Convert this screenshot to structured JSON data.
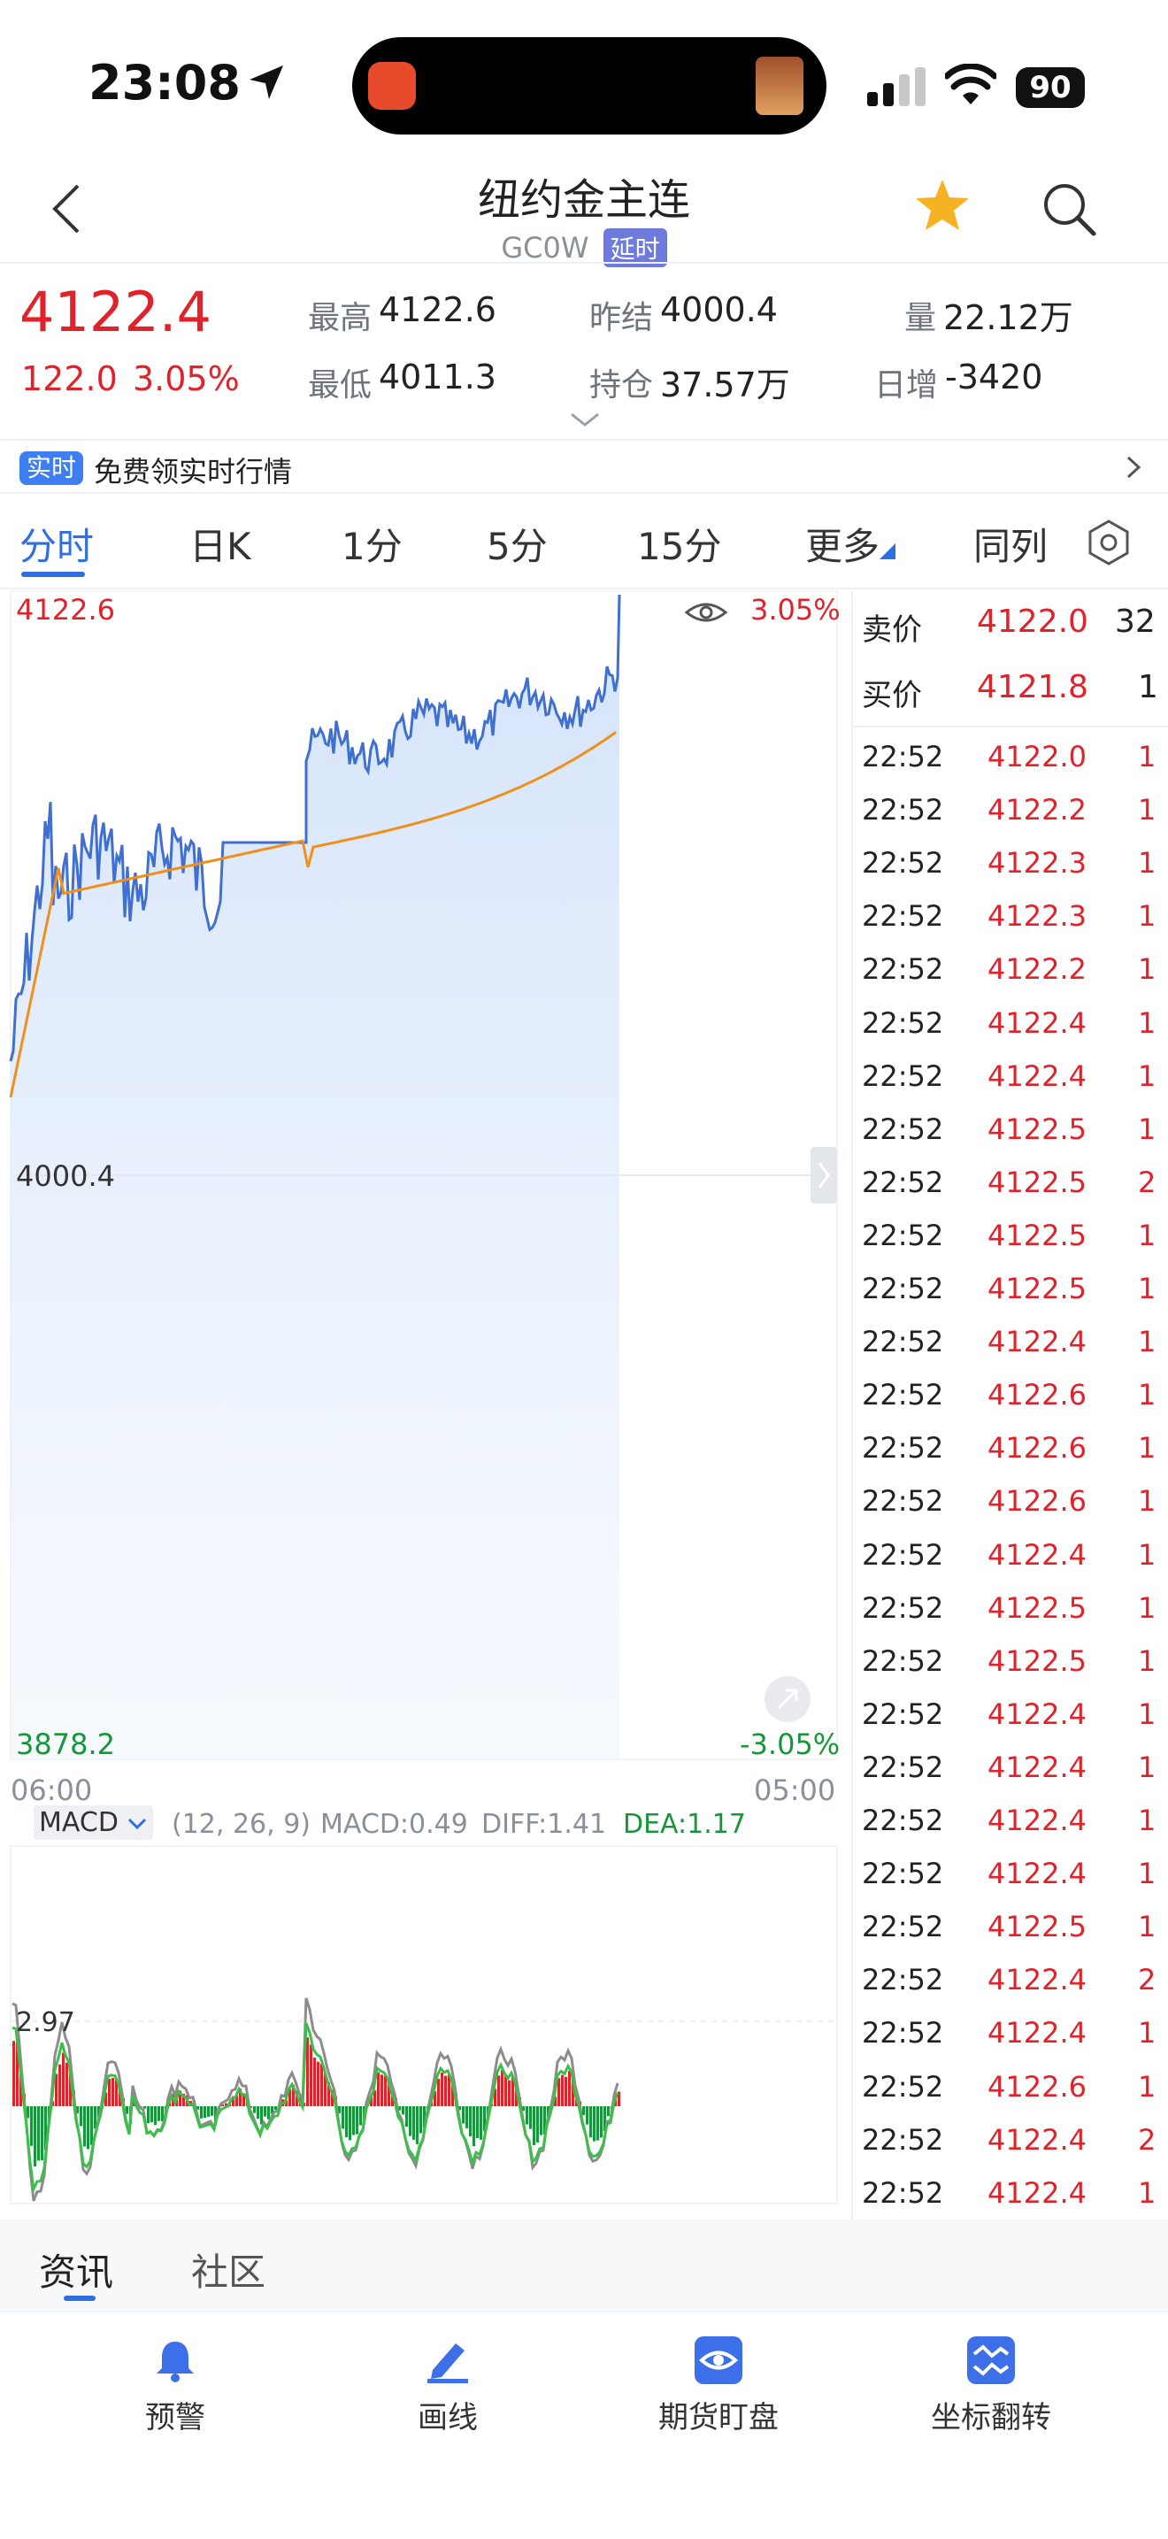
{
  "status": {
    "time": "23:08",
    "battery": "90"
  },
  "header": {
    "title": "纽约金主连",
    "code": "GC0W",
    "delay_badge": "延时"
  },
  "quote": {
    "price": "4122.4",
    "change": "122.0",
    "change_pct": "3.05%",
    "high_label": "最高",
    "high": "4122.6",
    "low_label": "最低",
    "low": "4011.3",
    "prev_settle_label": "昨结",
    "prev_settle": "4000.4",
    "open_interest_label": "持仓",
    "open_interest": "37.57万",
    "volume_label": "量",
    "volume": "22.12万",
    "daily_increase_label": "日增",
    "daily_increase": "-3420"
  },
  "banner": {
    "tag": "实时",
    "text": "免费领实时行情"
  },
  "tabs": [
    "分时",
    "日K",
    "1分",
    "5分",
    "15分",
    "更多",
    "同列"
  ],
  "chart_labels": {
    "top_price": "4122.6",
    "top_pct": "3.05%",
    "mid_price": "4000.4",
    "bottom_price": "3878.2",
    "bottom_pct": "-3.05%",
    "time_start": "06:00",
    "time_end": "05:00"
  },
  "macd": {
    "selector": "MACD",
    "params": "(12, 26, 9)",
    "macd_label": "MACD:",
    "macd_value": "0.49",
    "diff_label": "DIFF:",
    "diff_value": "1.41",
    "dea_label": "DEA:",
    "dea_value": "1.17",
    "level": "2.97"
  },
  "order_book": {
    "ask_label": "卖价",
    "ask_price": "4122.0",
    "ask_qty": "32",
    "bid_label": "买价",
    "bid_price": "4121.8",
    "bid_qty": "1"
  },
  "trades": [
    {
      "time": "22:52",
      "price": "4122.0",
      "qty": "1"
    },
    {
      "time": "22:52",
      "price": "4122.2",
      "qty": "1"
    },
    {
      "time": "22:52",
      "price": "4122.3",
      "qty": "1"
    },
    {
      "time": "22:52",
      "price": "4122.3",
      "qty": "1"
    },
    {
      "time": "22:52",
      "price": "4122.2",
      "qty": "1"
    },
    {
      "time": "22:52",
      "price": "4122.4",
      "qty": "1"
    },
    {
      "time": "22:52",
      "price": "4122.4",
      "qty": "1"
    },
    {
      "time": "22:52",
      "price": "4122.5",
      "qty": "1"
    },
    {
      "time": "22:52",
      "price": "4122.5",
      "qty": "2"
    },
    {
      "time": "22:52",
      "price": "4122.5",
      "qty": "1"
    },
    {
      "time": "22:52",
      "price": "4122.5",
      "qty": "1"
    },
    {
      "time": "22:52",
      "price": "4122.4",
      "qty": "1"
    },
    {
      "time": "22:52",
      "price": "4122.6",
      "qty": "1"
    },
    {
      "time": "22:52",
      "price": "4122.6",
      "qty": "1"
    },
    {
      "time": "22:52",
      "price": "4122.6",
      "qty": "1"
    },
    {
      "time": "22:52",
      "price": "4122.4",
      "qty": "1"
    },
    {
      "time": "22:52",
      "price": "4122.5",
      "qty": "1"
    },
    {
      "time": "22:52",
      "price": "4122.5",
      "qty": "1"
    },
    {
      "time": "22:52",
      "price": "4122.4",
      "qty": "1"
    },
    {
      "time": "22:52",
      "price": "4122.4",
      "qty": "1"
    },
    {
      "time": "22:52",
      "price": "4122.4",
      "qty": "1"
    },
    {
      "time": "22:52",
      "price": "4122.4",
      "qty": "1"
    },
    {
      "time": "22:52",
      "price": "4122.5",
      "qty": "1"
    },
    {
      "time": "22:52",
      "price": "4122.4",
      "qty": "2"
    },
    {
      "time": "22:52",
      "price": "4122.4",
      "qty": "1"
    },
    {
      "time": "22:52",
      "price": "4122.6",
      "qty": "1"
    },
    {
      "time": "22:52",
      "price": "4122.4",
      "qty": "2"
    },
    {
      "time": "22:52",
      "price": "4122.4",
      "qty": "1"
    }
  ],
  "bottom_tabs": [
    "资讯",
    "社区"
  ],
  "nav": [
    {
      "label": "预警",
      "icon": "bell-icon"
    },
    {
      "label": "画线",
      "icon": "pen-icon"
    },
    {
      "label": "期货盯盘",
      "icon": "eye-icon"
    },
    {
      "label": "坐标翻转",
      "icon": "flip-axis-icon"
    }
  ],
  "colors": {
    "up": "#e0232b",
    "down": "#15973a",
    "accent": "#2f6fe0",
    "price_line": "#3f6fd0",
    "avg_line": "#f0901a"
  }
}
